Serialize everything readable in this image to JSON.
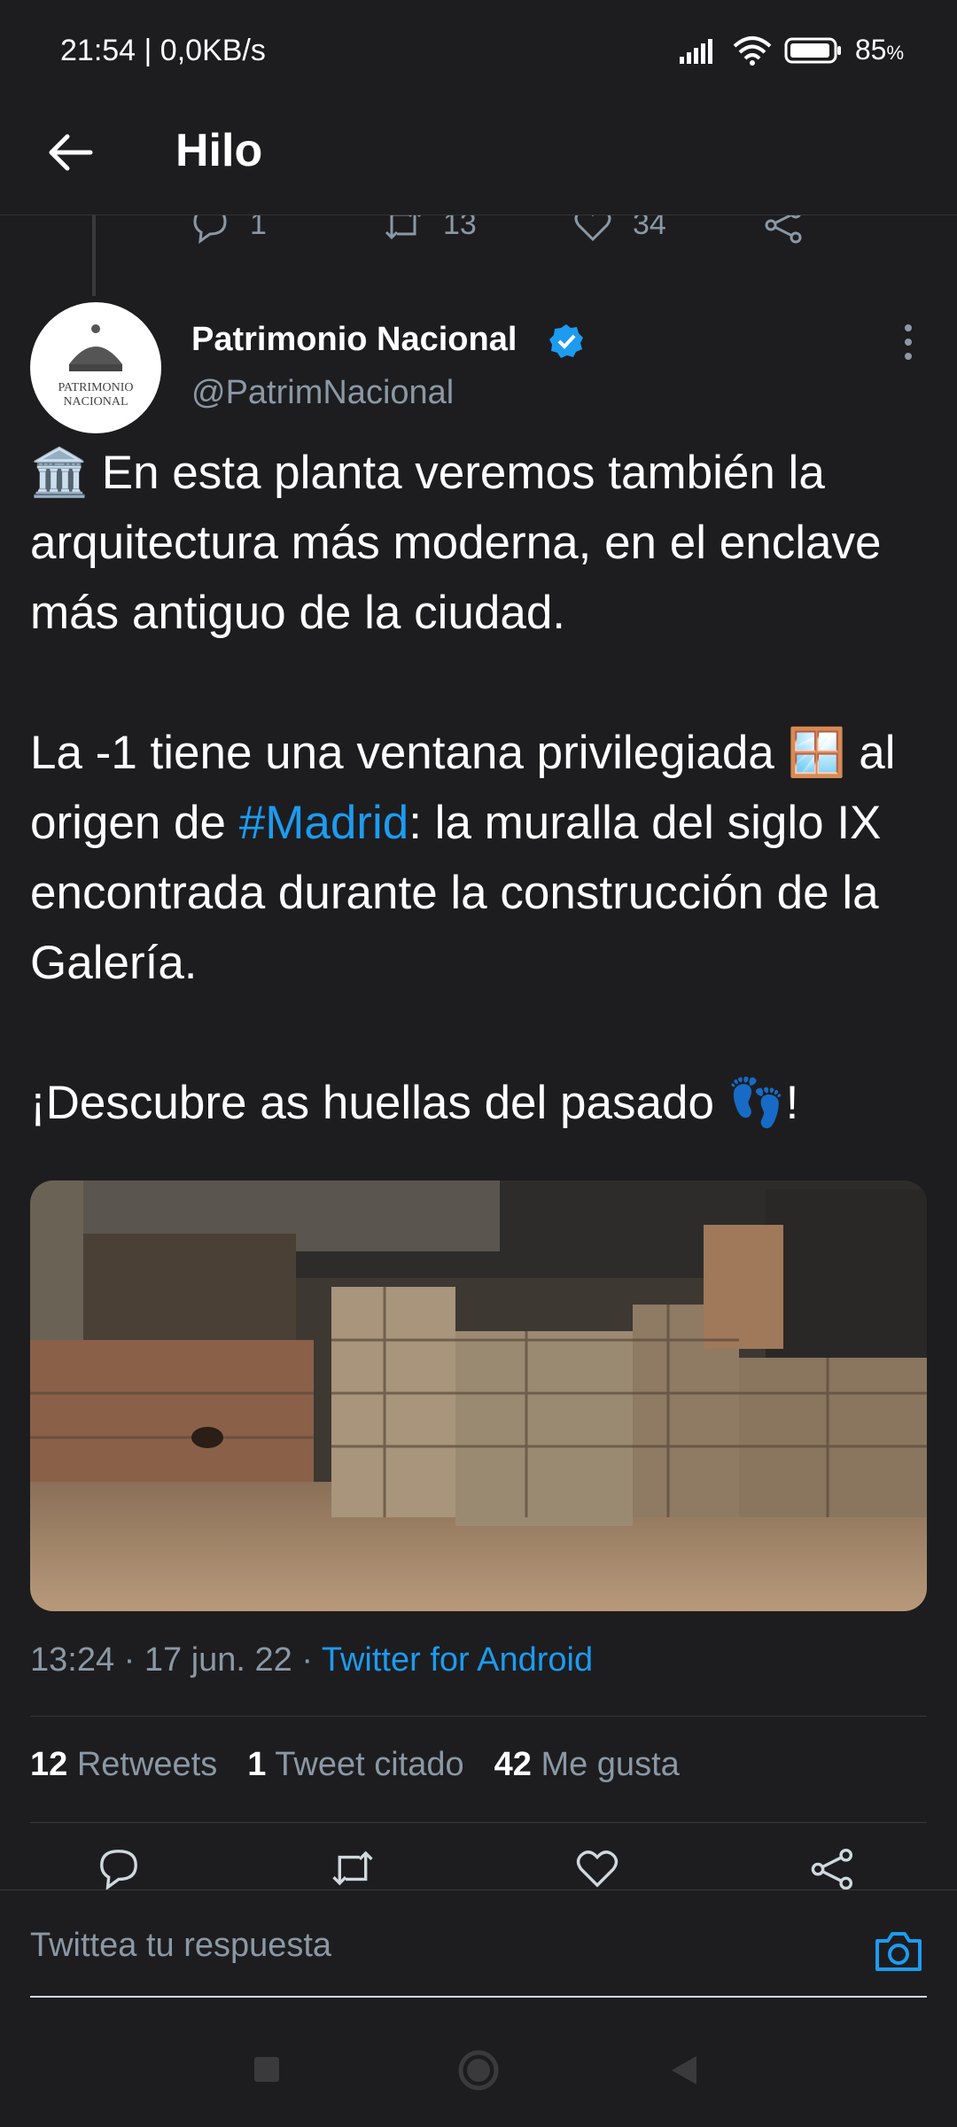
{
  "status_bar": {
    "time": "21:54 | 0,0KB/s",
    "battery": "85",
    "battery_unit": "%"
  },
  "header": {
    "title": "Hilo"
  },
  "previous_tweet_actions": {
    "replies": "1",
    "retweets": "13",
    "likes": "34"
  },
  "tweet": {
    "author_name": "Patrimonio Nacional",
    "handle": "@PatrimNacional",
    "avatar_text_line1": "PATRIMONIO",
    "avatar_text_line2": "NACIONAL",
    "p1_emoji": "🏛️",
    "p1_text": " En esta planta veremos también la arquitectura más moderna, en el enclave más antiguo de la ciudad.",
    "p2_text_a": "La -1 tiene una ventana privilegiada ",
    "p2_emoji": "🪟",
    "p2_text_b": " al origen de ",
    "p2_hashtag": "#Madrid",
    "p2_text_c": ": la muralla del siglo IX encontrada durante la construcción de la Galería.",
    "p3_text_a": "¡Descubre as huellas del pasado ",
    "p3_emoji": "👣",
    "p3_text_b": "!",
    "time": "13:24 · 17 jun. 22 · ",
    "source": "Twitter for Android"
  },
  "stats": {
    "retweets_count": "12",
    "retweets_label": "Retweets",
    "quotes_count": "1",
    "quotes_label": "Tweet citado",
    "likes_count": "42",
    "likes_label": "Me gusta"
  },
  "reply": {
    "placeholder": "Twittea tu respuesta"
  },
  "colors": {
    "accent": "#1d9bf0",
    "background": "#1d1d1f",
    "muted": "#8b98a5"
  },
  "icons": {
    "back": "arrow-left-icon",
    "verified": "verified-badge-icon",
    "more": "more-vertical-icon",
    "reply": "reply-icon",
    "retweet": "retweet-icon",
    "like": "heart-icon",
    "share": "share-icon",
    "camera": "camera-icon"
  }
}
